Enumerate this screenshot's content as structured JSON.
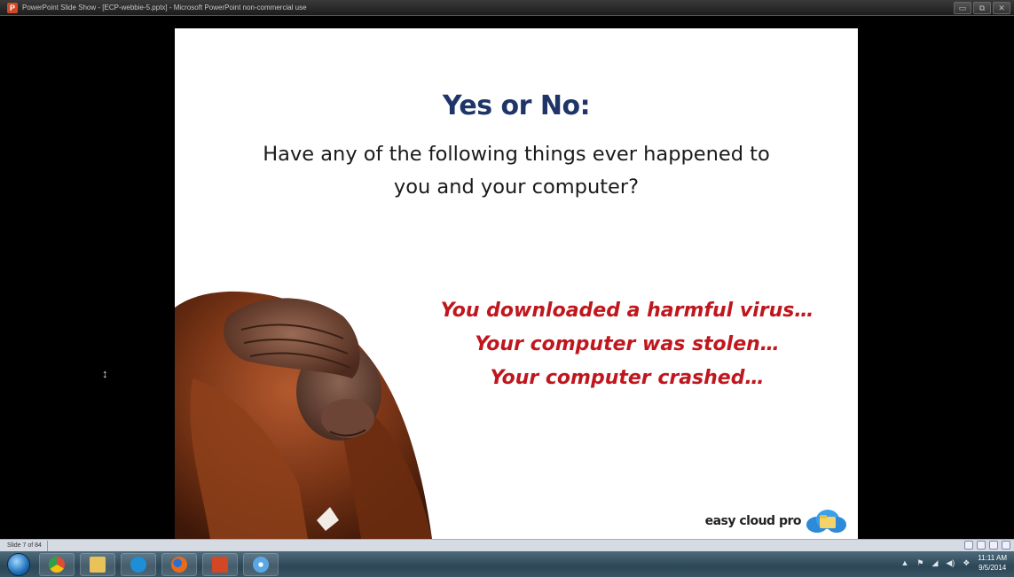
{
  "window": {
    "app_icon_letter": "P",
    "title": "PowerPoint Slide Show - [ECP-webbie-5.pptx] - Microsoft PowerPoint non-commercial use",
    "controls": [
      "▭",
      "⧉",
      "✕"
    ]
  },
  "slide": {
    "title": "Yes or No:",
    "question_lines": [
      "Have any of the following things ever happened to",
      "you and your computer?"
    ],
    "bullets": [
      "You downloaded a harmful virus…",
      "Your computer was stolen…",
      "Your computer crashed…"
    ],
    "brand": "easy cloud pro",
    "colors": {
      "title": "#1f3567",
      "bullets": "#c0161d",
      "question": "#1a1a1a"
    }
  },
  "cursor_glyph": "↕",
  "statusbar": {
    "slide_counter": "Slide 7 of 84"
  },
  "taskbar": {
    "apps": [
      {
        "name": "chrome-icon",
        "color": "#e04b36"
      },
      {
        "name": "file-explorer-icon",
        "color": "#e9c35a"
      },
      {
        "name": "skype-icon",
        "color": "#1e8ed6"
      },
      {
        "name": "firefox-icon",
        "color": "#e66a1f"
      },
      {
        "name": "powerpoint-icon",
        "color": "#d24726"
      },
      {
        "name": "snowflake-app-icon",
        "color": "#5aa7e6"
      }
    ],
    "clock_time": "11:11 AM",
    "clock_date": "9/5/2014"
  }
}
